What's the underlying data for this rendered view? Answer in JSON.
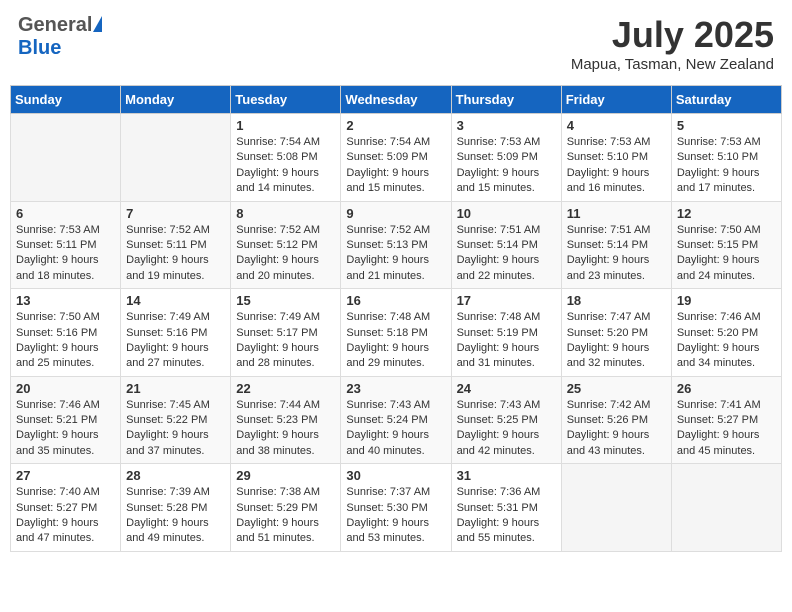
{
  "header": {
    "logo_general": "General",
    "logo_blue": "Blue",
    "month_title": "July 2025",
    "location": "Mapua, Tasman, New Zealand"
  },
  "days_of_week": [
    "Sunday",
    "Monday",
    "Tuesday",
    "Wednesday",
    "Thursday",
    "Friday",
    "Saturday"
  ],
  "weeks": [
    [
      {
        "day": "",
        "info": ""
      },
      {
        "day": "",
        "info": ""
      },
      {
        "day": "1",
        "info": "Sunrise: 7:54 AM\nSunset: 5:08 PM\nDaylight: 9 hours\nand 14 minutes."
      },
      {
        "day": "2",
        "info": "Sunrise: 7:54 AM\nSunset: 5:09 PM\nDaylight: 9 hours\nand 15 minutes."
      },
      {
        "day": "3",
        "info": "Sunrise: 7:53 AM\nSunset: 5:09 PM\nDaylight: 9 hours\nand 15 minutes."
      },
      {
        "day": "4",
        "info": "Sunrise: 7:53 AM\nSunset: 5:10 PM\nDaylight: 9 hours\nand 16 minutes."
      },
      {
        "day": "5",
        "info": "Sunrise: 7:53 AM\nSunset: 5:10 PM\nDaylight: 9 hours\nand 17 minutes."
      }
    ],
    [
      {
        "day": "6",
        "info": "Sunrise: 7:53 AM\nSunset: 5:11 PM\nDaylight: 9 hours\nand 18 minutes."
      },
      {
        "day": "7",
        "info": "Sunrise: 7:52 AM\nSunset: 5:11 PM\nDaylight: 9 hours\nand 19 minutes."
      },
      {
        "day": "8",
        "info": "Sunrise: 7:52 AM\nSunset: 5:12 PM\nDaylight: 9 hours\nand 20 minutes."
      },
      {
        "day": "9",
        "info": "Sunrise: 7:52 AM\nSunset: 5:13 PM\nDaylight: 9 hours\nand 21 minutes."
      },
      {
        "day": "10",
        "info": "Sunrise: 7:51 AM\nSunset: 5:14 PM\nDaylight: 9 hours\nand 22 minutes."
      },
      {
        "day": "11",
        "info": "Sunrise: 7:51 AM\nSunset: 5:14 PM\nDaylight: 9 hours\nand 23 minutes."
      },
      {
        "day": "12",
        "info": "Sunrise: 7:50 AM\nSunset: 5:15 PM\nDaylight: 9 hours\nand 24 minutes."
      }
    ],
    [
      {
        "day": "13",
        "info": "Sunrise: 7:50 AM\nSunset: 5:16 PM\nDaylight: 9 hours\nand 25 minutes."
      },
      {
        "day": "14",
        "info": "Sunrise: 7:49 AM\nSunset: 5:16 PM\nDaylight: 9 hours\nand 27 minutes."
      },
      {
        "day": "15",
        "info": "Sunrise: 7:49 AM\nSunset: 5:17 PM\nDaylight: 9 hours\nand 28 minutes."
      },
      {
        "day": "16",
        "info": "Sunrise: 7:48 AM\nSunset: 5:18 PM\nDaylight: 9 hours\nand 29 minutes."
      },
      {
        "day": "17",
        "info": "Sunrise: 7:48 AM\nSunset: 5:19 PM\nDaylight: 9 hours\nand 31 minutes."
      },
      {
        "day": "18",
        "info": "Sunrise: 7:47 AM\nSunset: 5:20 PM\nDaylight: 9 hours\nand 32 minutes."
      },
      {
        "day": "19",
        "info": "Sunrise: 7:46 AM\nSunset: 5:20 PM\nDaylight: 9 hours\nand 34 minutes."
      }
    ],
    [
      {
        "day": "20",
        "info": "Sunrise: 7:46 AM\nSunset: 5:21 PM\nDaylight: 9 hours\nand 35 minutes."
      },
      {
        "day": "21",
        "info": "Sunrise: 7:45 AM\nSunset: 5:22 PM\nDaylight: 9 hours\nand 37 minutes."
      },
      {
        "day": "22",
        "info": "Sunrise: 7:44 AM\nSunset: 5:23 PM\nDaylight: 9 hours\nand 38 minutes."
      },
      {
        "day": "23",
        "info": "Sunrise: 7:43 AM\nSunset: 5:24 PM\nDaylight: 9 hours\nand 40 minutes."
      },
      {
        "day": "24",
        "info": "Sunrise: 7:43 AM\nSunset: 5:25 PM\nDaylight: 9 hours\nand 42 minutes."
      },
      {
        "day": "25",
        "info": "Sunrise: 7:42 AM\nSunset: 5:26 PM\nDaylight: 9 hours\nand 43 minutes."
      },
      {
        "day": "26",
        "info": "Sunrise: 7:41 AM\nSunset: 5:27 PM\nDaylight: 9 hours\nand 45 minutes."
      }
    ],
    [
      {
        "day": "27",
        "info": "Sunrise: 7:40 AM\nSunset: 5:27 PM\nDaylight: 9 hours\nand 47 minutes."
      },
      {
        "day": "28",
        "info": "Sunrise: 7:39 AM\nSunset: 5:28 PM\nDaylight: 9 hours\nand 49 minutes."
      },
      {
        "day": "29",
        "info": "Sunrise: 7:38 AM\nSunset: 5:29 PM\nDaylight: 9 hours\nand 51 minutes."
      },
      {
        "day": "30",
        "info": "Sunrise: 7:37 AM\nSunset: 5:30 PM\nDaylight: 9 hours\nand 53 minutes."
      },
      {
        "day": "31",
        "info": "Sunrise: 7:36 AM\nSunset: 5:31 PM\nDaylight: 9 hours\nand 55 minutes."
      },
      {
        "day": "",
        "info": ""
      },
      {
        "day": "",
        "info": ""
      }
    ]
  ]
}
